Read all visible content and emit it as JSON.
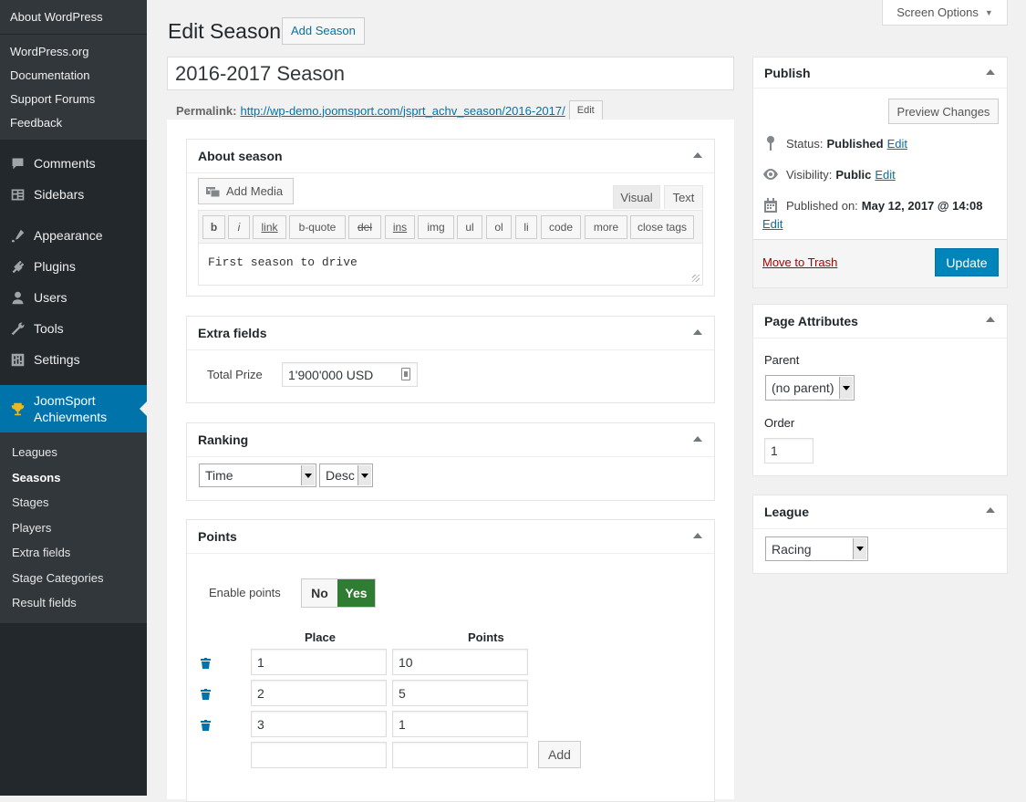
{
  "sidebar": {
    "about": "About WordPress",
    "links": [
      "WordPress.org",
      "Documentation",
      "Support Forums",
      "Feedback"
    ],
    "menu": [
      {
        "label": "Comments",
        "icon": "comments-icon"
      },
      {
        "label": "Sidebars",
        "icon": "sidebars-icon"
      },
      {
        "label": "Appearance",
        "icon": "appearance-icon"
      },
      {
        "label": "Plugins",
        "icon": "plugins-icon"
      },
      {
        "label": "Users",
        "icon": "users-icon"
      },
      {
        "label": "Tools",
        "icon": "tools-icon"
      },
      {
        "label": "Settings",
        "icon": "settings-icon"
      }
    ],
    "active_line1": "JoomSport",
    "active_line2": "Achievments",
    "submenu": [
      "Leagues",
      "Seasons",
      "Stages",
      "Players",
      "Extra fields",
      "Stage Categories",
      "Result fields"
    ],
    "current_submenu": "Seasons"
  },
  "header": {
    "screen_options": "Screen Options",
    "title": "Edit Season",
    "add_button": "Add Season"
  },
  "post": {
    "title": "2016-2017 Season",
    "permalink_label": "Permalink:",
    "permalink_url": "http://wp-demo.joomsport.com/jsprt_achv_season/2016-2017/",
    "permalink_edit": "Edit"
  },
  "about_box": {
    "title": "About season",
    "add_media": "Add Media",
    "tab_visual": "Visual",
    "tab_text": "Text",
    "toolbar": [
      "b",
      "i",
      "link",
      "b-quote",
      "del",
      "ins",
      "img",
      "ul",
      "ol",
      "li",
      "code",
      "more",
      "close tags"
    ],
    "content": "First season to drive"
  },
  "extra_fields": {
    "title": "Extra fields",
    "label": "Total Prize",
    "value": "1'900'000 USD"
  },
  "ranking": {
    "title": "Ranking",
    "sort_by": "Time",
    "order": "Desc"
  },
  "points": {
    "title": "Points",
    "enable_label": "Enable points",
    "no": "No",
    "yes": "Yes",
    "col_place": "Place",
    "col_points": "Points",
    "rows": [
      {
        "place": "1",
        "points": "10"
      },
      {
        "place": "2",
        "points": "5"
      },
      {
        "place": "3",
        "points": "1"
      }
    ],
    "add": "Add"
  },
  "publish": {
    "title": "Publish",
    "preview": "Preview Changes",
    "status_label": "Status:",
    "status_value": "Published",
    "visibility_label": "Visibility:",
    "visibility_value": "Public",
    "published_label": "Published on:",
    "published_value": "May 12, 2017 @ 14:08",
    "edit": "Edit",
    "trash": "Move to Trash",
    "update": "Update"
  },
  "page_attributes": {
    "title": "Page Attributes",
    "parent_label": "Parent",
    "parent_value": "(no parent)",
    "order_label": "Order",
    "order_value": "1"
  },
  "league": {
    "title": "League",
    "value": "Racing"
  },
  "colors": {
    "sidebar_bg": "#23282d",
    "active_menu": "#0073aa",
    "primary_button": "#0085ba",
    "toggle_yes": "#2e7d32"
  }
}
